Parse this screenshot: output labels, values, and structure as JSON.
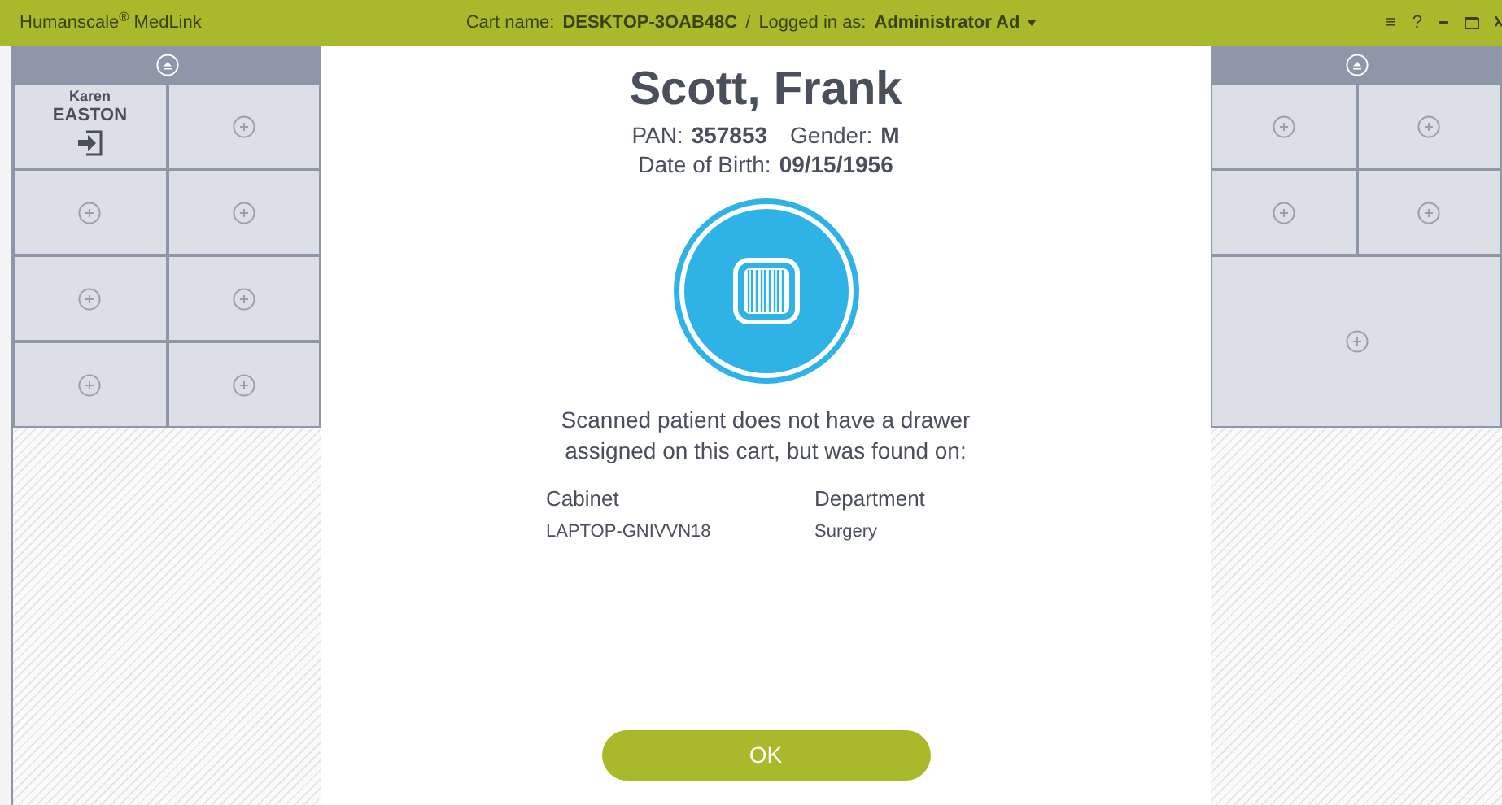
{
  "title_bar": {
    "app_name": "Humanscale$^{®}$ MedLink",
    "cart_label": "Cart name:",
    "cart_name": "DESKTOP-3OAB48C",
    "separator": "/",
    "logged_label": "Logged in as:",
    "user": "Administrator Ad",
    "menu_glyph": "≡",
    "help_glyph": "?"
  },
  "left_cart": {
    "drawers": [
      {
        "kind": "patient",
        "first_name": "Karen",
        "last_name": "EASTON"
      },
      {
        "kind": "empty"
      },
      {
        "kind": "empty"
      },
      {
        "kind": "empty"
      },
      {
        "kind": "empty"
      },
      {
        "kind": "empty"
      },
      {
        "kind": "empty"
      },
      {
        "kind": "empty"
      }
    ]
  },
  "right_cart": {
    "drawers": [
      {
        "kind": "empty"
      },
      {
        "kind": "empty"
      },
      {
        "kind": "empty"
      },
      {
        "kind": "empty"
      },
      {
        "kind": "wide"
      }
    ]
  },
  "dialog": {
    "patient_name": "Scott, Frank",
    "fields": [
      {
        "label": "PAN:",
        "value": "357853"
      },
      {
        "label": "Gender:",
        "value": "M"
      },
      {
        "label": "Date of Birth:",
        "value": "09/15/1956"
      }
    ],
    "message": "Scanned patient does not have a drawer assigned on this cart, but was found on:",
    "table": {
      "columns": [
        "Cabinet",
        "Department"
      ],
      "rows": [
        [
          "LAPTOP-GNIVVN18",
          "Surgery"
        ]
      ]
    },
    "ok_button": "OK"
  }
}
